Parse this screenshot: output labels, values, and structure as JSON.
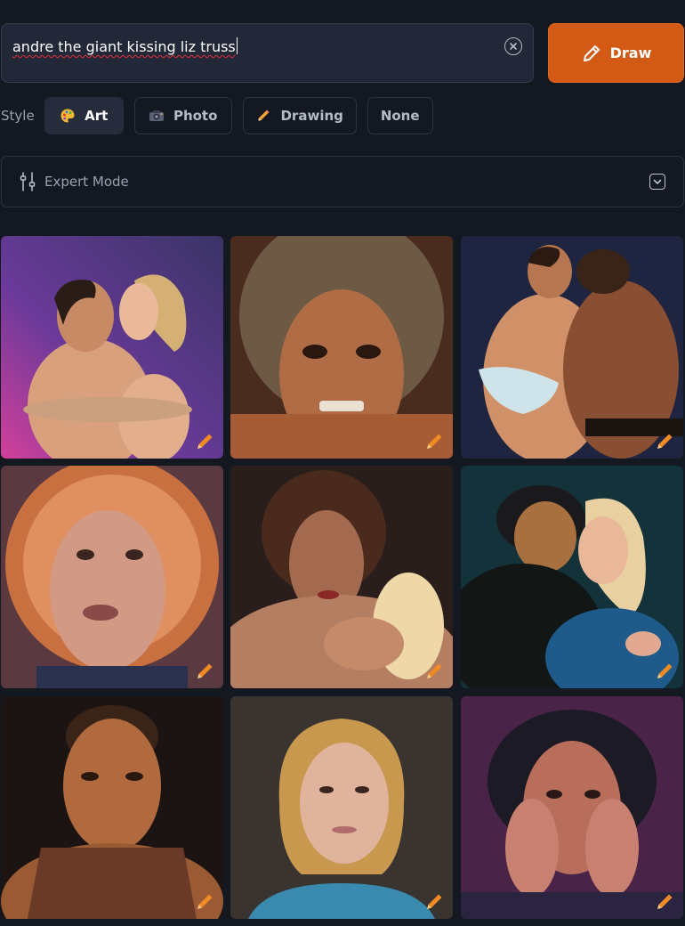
{
  "prompt": {
    "value": "andre the giant kissing liz truss",
    "clear_icon": "close-circle-icon"
  },
  "draw_button": {
    "label": "Draw",
    "icon": "pencil-icon",
    "color": "#d25a14"
  },
  "style": {
    "label": "Style",
    "options": [
      {
        "label": "Art",
        "icon": "palette-icon",
        "selected": true
      },
      {
        "label": "Photo",
        "icon": "camera-icon",
        "selected": false
      },
      {
        "label": "Drawing",
        "icon": "pencil-icon",
        "selected": false
      },
      {
        "label": "None",
        "icon": "",
        "selected": false
      }
    ]
  },
  "expert_mode": {
    "label": "Expert Mode",
    "icon": "sliders-icon",
    "toggle_icon": "chevron-down-icon"
  },
  "results": {
    "edit_icon": "pencil-icon",
    "edit_color": "#f08a24",
    "images": [
      {
        "name": "result-image-1"
      },
      {
        "name": "result-image-2"
      },
      {
        "name": "result-image-3"
      },
      {
        "name": "result-image-4"
      },
      {
        "name": "result-image-5"
      },
      {
        "name": "result-image-6"
      },
      {
        "name": "result-image-7"
      },
      {
        "name": "result-image-8"
      },
      {
        "name": "result-image-9"
      }
    ]
  }
}
